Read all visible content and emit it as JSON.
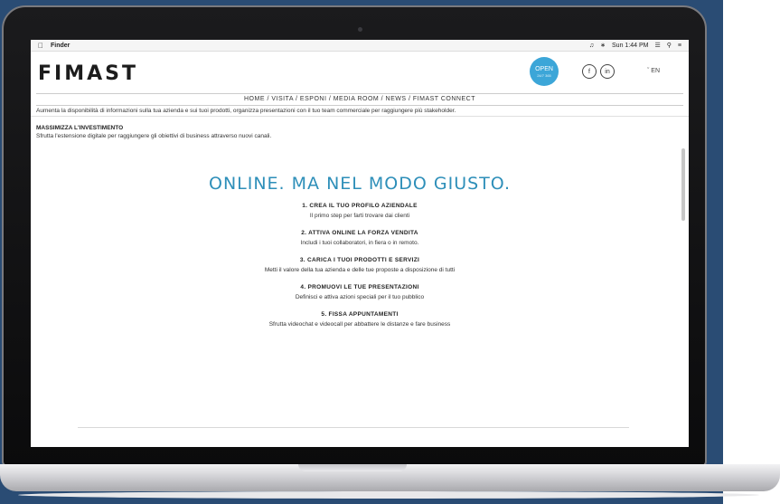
{
  "menubar": {
    "app_name": "Finder",
    "clock": "Sun 1:44 PM",
    "volume_icon": "volume-icon",
    "bluetooth_icon": "bluetooth-icon",
    "wifi_icon": "wifi-icon",
    "search_icon": "search-icon",
    "list_icon": "list-icon"
  },
  "header": {
    "logo": "FIMAST",
    "badge": {
      "label": "OPEN",
      "sub": "24/7 365"
    },
    "social": {
      "facebook": "f",
      "linkedin": "in"
    },
    "language": "EN"
  },
  "nav": {
    "items": [
      "HOME",
      "VISITA",
      "ESPONI",
      "MEDIA ROOM",
      "NEWS",
      "FIMAST CONNECT"
    ],
    "text": "HOME / VISITA / ESPONI / MEDIA ROOM / NEWS / FIMAST CONNECT"
  },
  "content": {
    "intro": "Aumenta la disponibilità di informazioni sulla tua azienda e sui tuoi prodotti, organizza presentazioni con il tuo team commerciale per raggiungere più stakeholder.",
    "section_title": "MASSIMIZZA L'INVESTIMENTO",
    "section_text": "Sfrutta l'estensione digitale per raggiungere gli obiettivi di business attraverso nuovi canali.",
    "headline": "ONLINE. MA NEL MODO GIUSTO.",
    "steps": [
      {
        "title": "1.   CREA IL TUO PROFILO AZIENDALE",
        "desc": "Il primo step per farti trovare dai clienti"
      },
      {
        "title": "2.   ATTIVA ONLINE LA FORZA VENDITA",
        "desc": "Includi i tuoi collaboratori, in fiera o in remoto."
      },
      {
        "title": "3.   CARICA I TUOI PRODOTTI E SERVIZI",
        "desc": "Metti il valore della tua azienda e delle tue proposte a disposizione di tutti"
      },
      {
        "title": "4.   PROMUOVI LE TUE PRESENTAZIONI",
        "desc": "Definisci e attiva azioni speciali per il tuo pubblico"
      },
      {
        "title": "5.   FISSA APPUNTAMENTI",
        "desc": "Sfrutta videochat e videocall per abbattere le distanze e fare business"
      }
    ]
  }
}
